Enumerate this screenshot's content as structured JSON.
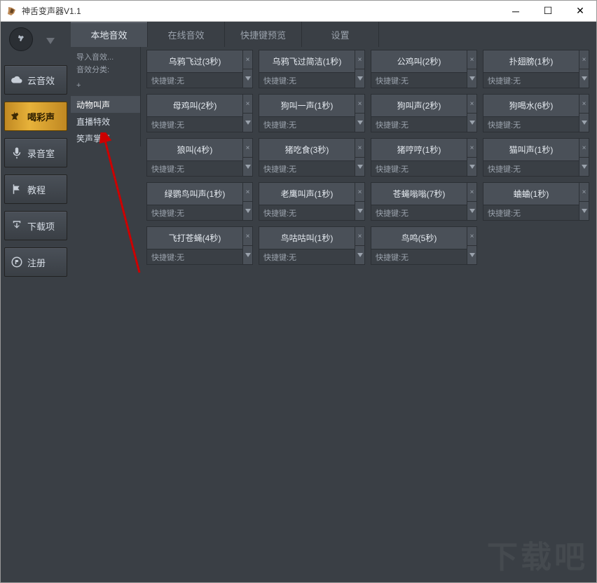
{
  "window": {
    "title": "神舌变声器V1.1"
  },
  "nav": {
    "items": [
      {
        "label": "云音效"
      },
      {
        "label": "喝彩声"
      },
      {
        "label": "录音室"
      },
      {
        "label": "教程"
      },
      {
        "label": "下载项"
      },
      {
        "label": "注册"
      }
    ]
  },
  "tabs": [
    {
      "label": "本地音效"
    },
    {
      "label": "在线音效"
    },
    {
      "label": "快捷键预览"
    },
    {
      "label": "设置"
    }
  ],
  "classify": {
    "import": "导入音效...",
    "label": "音效分类:",
    "plus": "+"
  },
  "categories": [
    {
      "label": "动物叫声"
    },
    {
      "label": "直播特效"
    },
    {
      "label": "笑声掌声"
    }
  ],
  "hotkey_prefix": "快捷键:",
  "hotkey_none": "无",
  "cards": [
    {
      "name": "乌鸦飞过(3秒)"
    },
    {
      "name": "乌鸦飞过简洁(1秒)"
    },
    {
      "name": "公鸡叫(2秒)"
    },
    {
      "name": "扑翅膀(1秒)"
    },
    {
      "name": "母鸡叫(2秒)"
    },
    {
      "name": "狗叫一声(1秒)"
    },
    {
      "name": "狗叫声(2秒)"
    },
    {
      "name": "狗喝水(6秒)"
    },
    {
      "name": "狼叫(4秒)"
    },
    {
      "name": "猪吃食(3秒)"
    },
    {
      "name": "猪哼哼(1秒)"
    },
    {
      "name": "猫叫声(1秒)"
    },
    {
      "name": "绿鹦鸟叫声(1秒)"
    },
    {
      "name": "老鹰叫声(1秒)"
    },
    {
      "name": "苍蝇嗡嗡(7秒)"
    },
    {
      "name": "蛐蛐(1秒)"
    },
    {
      "name": "飞打苍蝇(4秒)"
    },
    {
      "name": "鸟咕咕叫(1秒)"
    },
    {
      "name": "鸟鸣(5秒)"
    }
  ],
  "watermark": "下载吧"
}
